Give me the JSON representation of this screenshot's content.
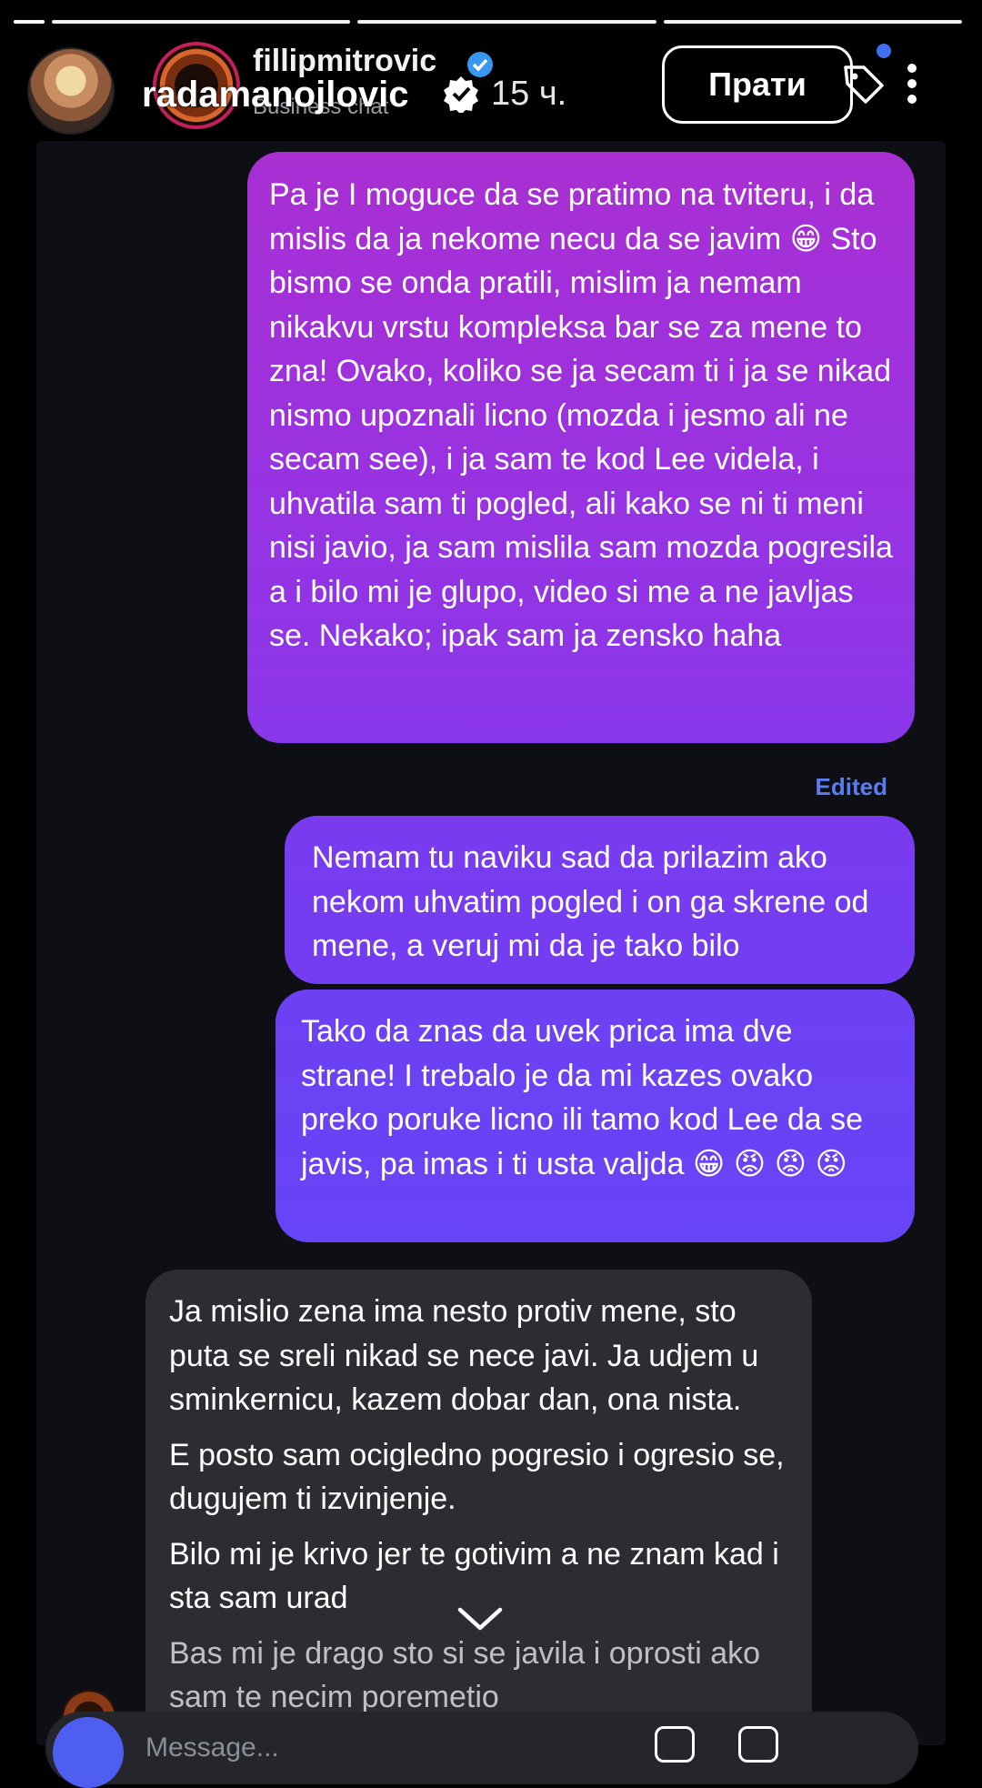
{
  "progress": {
    "segments": 4
  },
  "dm_header": {
    "username": "fillipmitrovic",
    "subtitle": "Business chat"
  },
  "story_header": {
    "username": "radamanojlovic",
    "time": "15 ч.",
    "follow_label": "Прати"
  },
  "messages": {
    "m1": "Pa je I moguce da se pratimo na tviteru, i da mislis da ja nekome necu da se javim 😁 Sto bismo se onda pratili, mislim ja nemam nikakvu vrstu kompleksa bar se za mene to zna! Ovako, koliko se ja secam ti i ja se nikad nismo upoznali licno (mozda i jesmo ali ne secam see), i ja sam te kod Lee videla, i uhvatila sam ti pogled, ali kako se ni ti meni nisi javio, ja sam mislila sam mozda pogresila a i bilo mi je glupo, video si me a ne javljas se. Nekako; ipak sam ja zensko haha",
    "m1_edited": "Edited",
    "m2": "Nemam tu naviku sad da prilazim ako nekom uhvatim pogled i on ga skrene od mene, a veruj mi da je tako bilo",
    "m3": "Tako da znas da uvek prica ima dve strane! I trebalo je da mi kazes ovako preko poruke licno ili tamo kod Lee da se javis, pa imas i ti usta valjda 😁 😡 😡 😡",
    "m4_p1": "Ja mislio zena ima nesto protiv mene, sto puta se sreli nikad se nece javi. Ja udjem u sminkernicu, kazem dobar dan, ona nista.",
    "m4_p2": "E posto sam ocigledno pogresio i ogresio se, dugujem ti izvinjenje.",
    "m4_p3": "Bilo mi je krivo jer te gotivim a ne znam kad i sta sam urad",
    "m4_p4": "Bas mi je drago sto si se javila i oprosti ako sam te necim poremetio"
  },
  "composer": {
    "placeholder": "Message..."
  }
}
